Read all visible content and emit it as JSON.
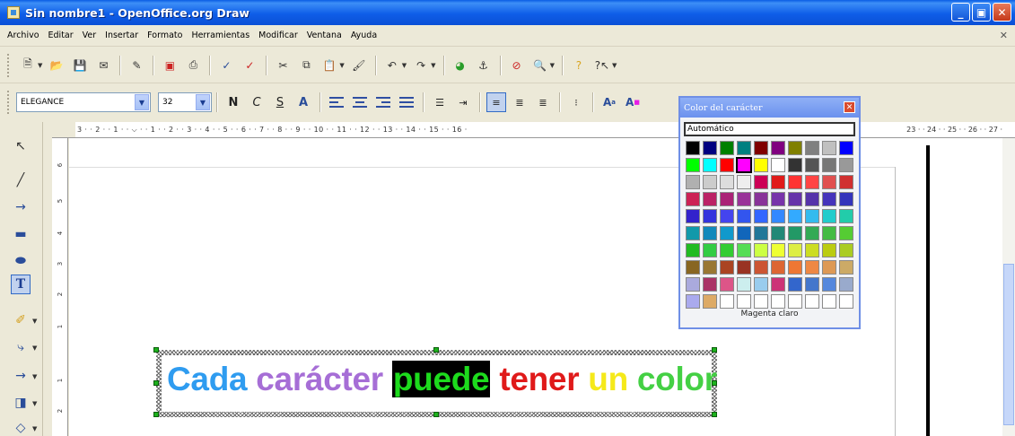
{
  "window": {
    "title": "Sin nombre1 - OpenOffice.org Draw"
  },
  "menu": [
    "Archivo",
    "Editar",
    "Ver",
    "Insertar",
    "Formato",
    "Herramientas",
    "Modificar",
    "Ventana",
    "Ayuda"
  ],
  "format_bar": {
    "font_name": "ELEGANCE",
    "font_size": "32",
    "bold": "N",
    "italic": "C",
    "underline": "S"
  },
  "ruler": {
    "h_ticks": "3 · · 2 · · 1 · · ⌵ · · 1 · · 2 · · 3 · · 4 · · 5 · · 6 · · 7 · · 8 · · 9 · · 10 · · 11 · · 12 · · 13 · · 14 · · 15 · · 16 ·",
    "h_ticks_right": "23 · · 24 · · 25 · · 26 · · 27 ·",
    "v_ticks": [
      "6",
      "5",
      "4",
      "3",
      "2",
      "1",
      "1",
      "2"
    ]
  },
  "canvas_text": {
    "words": [
      "Cada",
      "carácter",
      "puede",
      "tener",
      "un",
      "color"
    ]
  },
  "color_popup": {
    "title": "Color del carácter",
    "auto_label": "Automático",
    "selected_name": "Magenta claro",
    "swatches": [
      "#000000",
      "#000080",
      "#008000",
      "#008080",
      "#800000",
      "#800080",
      "#808000",
      "#808080",
      "#c0c0c0",
      "#0000ff",
      "#00ff00",
      "#00ffff",
      "#ff0000",
      "#ff00ff",
      "#ffff00",
      "#ffffff",
      "#333333",
      "#555555",
      "#777777",
      "#999999",
      "#b0b0b0",
      "#cccccc",
      "#dddddd",
      "#eeeeee",
      "#cc0055",
      "#e01a1a",
      "#ff3333",
      "#ff4444",
      "#e05050",
      "#d03030",
      "#cc2255",
      "#bb2266",
      "#aa2277",
      "#993399",
      "#883399",
      "#7733aa",
      "#6633aa",
      "#5533aa",
      "#4433bb",
      "#3333bb",
      "#3322cc",
      "#3333dd",
      "#4444ee",
      "#3355ee",
      "#3366ff",
      "#3388ff",
      "#33aaff",
      "#33bbee",
      "#22cccc",
      "#22ccaa",
      "#1199aa",
      "#1188bb",
      "#1199cc",
      "#1166bb",
      "#227799",
      "#228877",
      "#229966",
      "#33aa55",
      "#44bb44",
      "#55cc33",
      "#22bb22",
      "#33cc44",
      "#33cc33",
      "#55dd55",
      "#ccff44",
      "#eeff33",
      "#ddee44",
      "#ccdd22",
      "#bbcc11",
      "#aacc22",
      "#886622",
      "#997733",
      "#aa4422",
      "#993322",
      "#cc5533",
      "#dd6633",
      "#ee7733",
      "#ee8844",
      "#dd9955",
      "#ccaa66",
      "#aaaadd",
      "#aa3366",
      "#dd5588",
      "#cceeee",
      "#99ccee",
      "#cc3377",
      "#3366cc",
      "#4477cc",
      "#5588dd",
      "#99aacc",
      "#aaaaee",
      "#ddaa66",
      "#ffffff",
      "#ffffff",
      "#ffffff",
      "#ffffff",
      "#ffffff",
      "#ffffff",
      "#ffffff",
      "#ffffff"
    ]
  }
}
